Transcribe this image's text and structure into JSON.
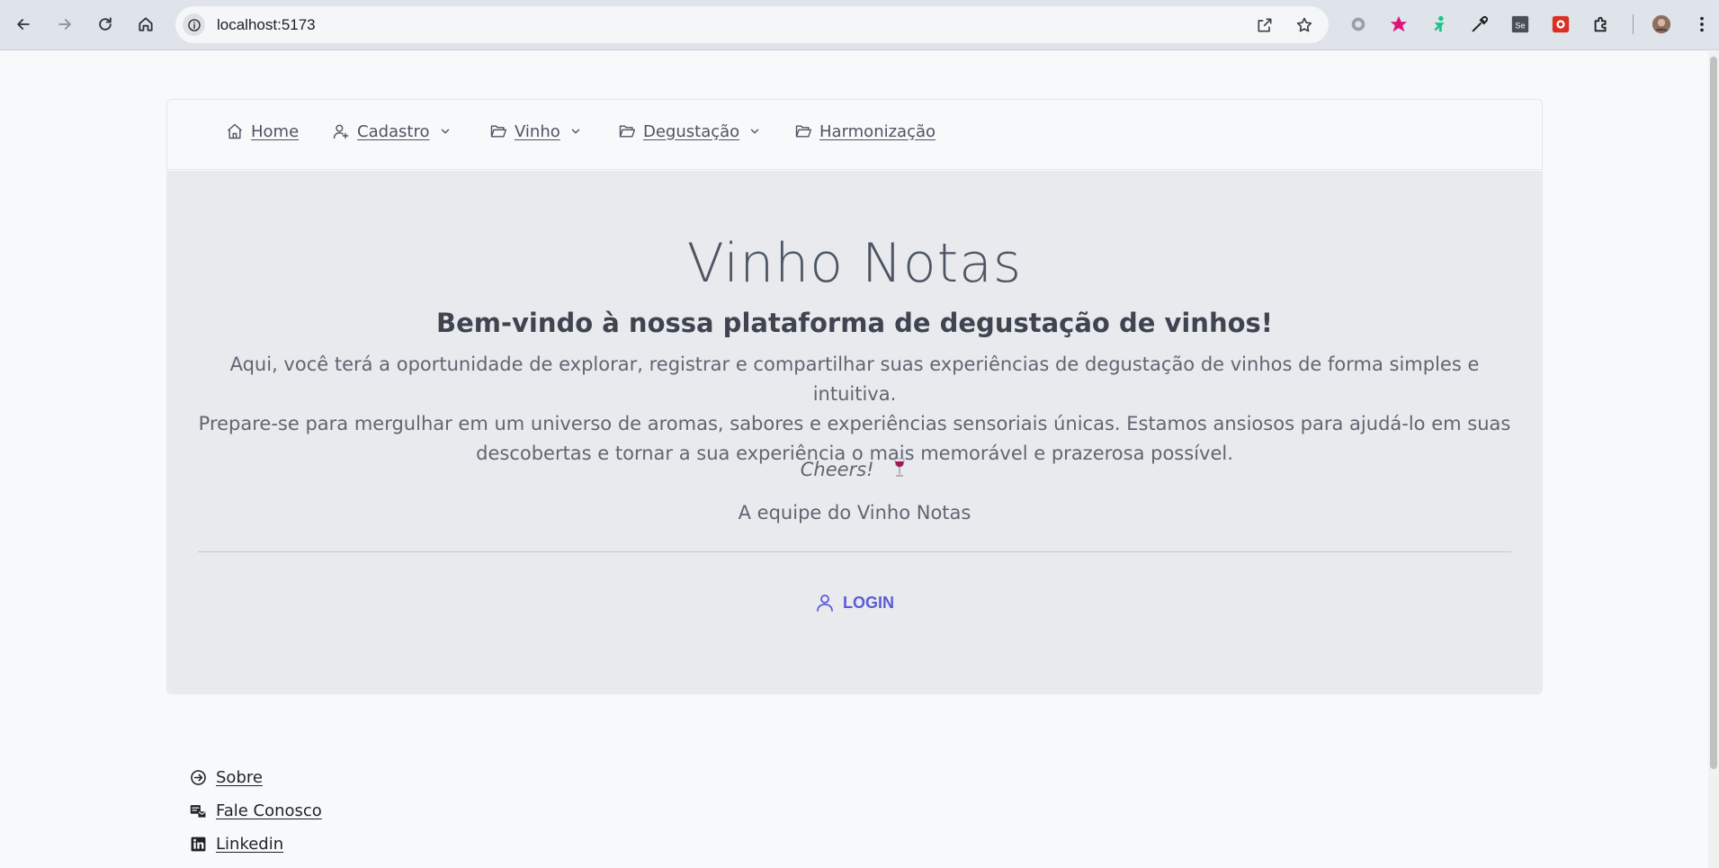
{
  "browser": {
    "url": "localhost:5173"
  },
  "navbar": {
    "items": [
      {
        "label": "Home",
        "icon": "home-icon",
        "has_dropdown": false
      },
      {
        "label": "Cadastro",
        "icon": "user-plus-icon",
        "has_dropdown": true
      },
      {
        "label": "Vinho",
        "icon": "folder-open-icon",
        "has_dropdown": true
      },
      {
        "label": "Degustação",
        "icon": "folder-open-icon",
        "has_dropdown": true
      },
      {
        "label": "Harmonização",
        "icon": "folder-open-icon",
        "has_dropdown": false
      }
    ]
  },
  "hero": {
    "title": "Vinho Notas",
    "subtitle": "Bem-vindo à nossa plataforma de degustação de vinhos!",
    "paragraph_lines": [
      "Aqui, você terá a oportunidade de explorar, registrar e compartilhar suas experiências de degustação de vinhos de forma simples e intuitiva.",
      "Prepare-se para mergulhar em um universo de aromas, sabores e experiências sensoriais únicas. Estamos ansiosos para ajudá-lo em suas",
      "descobertas e tornar a sua experiência o mais memorável e prazerosa possível."
    ],
    "cheers": "Cheers!",
    "signature": "A equipe do Vinho Notas",
    "login_label": "LOGIN"
  },
  "footer": {
    "links": [
      {
        "label": "Sobre",
        "icon": "arrow-circle-right-icon"
      },
      {
        "label": "Fale Conosco",
        "icon": "contact-icon"
      },
      {
        "label": "Linkedin",
        "icon": "linkedin-icon"
      }
    ]
  },
  "colors": {
    "page_bg": "#f8f9fb",
    "hero_bg": "#e8eaed",
    "login_accent": "#5b5bd6",
    "text_muted": "#5f6672"
  }
}
